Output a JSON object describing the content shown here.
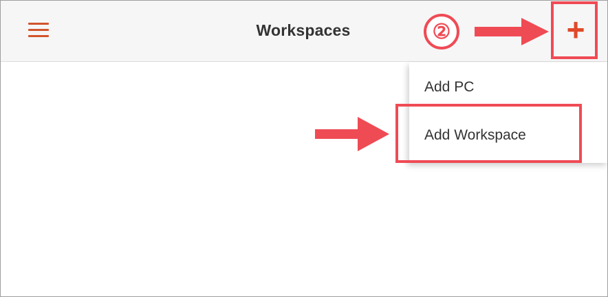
{
  "header": {
    "title": "Workspaces",
    "menu_icon": "hamburger-menu-icon",
    "add_icon": "plus-icon",
    "add_glyph": "+"
  },
  "add_menu": {
    "items": [
      {
        "label": "Add PC"
      },
      {
        "label": "Add Workspace"
      }
    ]
  },
  "annotations": {
    "step_label": "②",
    "arrow_icon": "right-arrow-icon",
    "highlight_color": "#ef4b55"
  },
  "colors": {
    "accent": "#e04a2a",
    "appbar_background": "#f6f6f6",
    "text": "#333333"
  }
}
